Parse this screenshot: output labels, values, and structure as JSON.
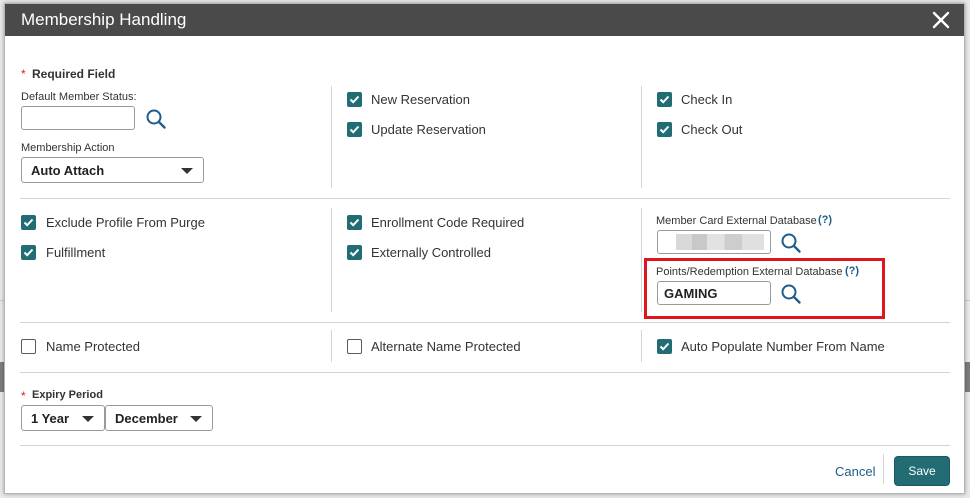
{
  "dialog": {
    "title": "Membership Handling"
  },
  "required_note": {
    "star": "*",
    "text": "Required Field"
  },
  "default_member_status": {
    "label": "Default Member Status:",
    "value": ""
  },
  "membership_action": {
    "label": "Membership Action",
    "value": "Auto Attach"
  },
  "checkboxes": {
    "new_reservation": {
      "label": "New Reservation",
      "checked": true
    },
    "update_reservation": {
      "label": "Update Reservation",
      "checked": true
    },
    "check_in": {
      "label": "Check In",
      "checked": true
    },
    "check_out": {
      "label": "Check Out",
      "checked": true
    },
    "exclude_profile": {
      "label": "Exclude Profile From Purge",
      "checked": true
    },
    "fulfillment": {
      "label": "Fulfillment",
      "checked": true
    },
    "enrollment_code": {
      "label": "Enrollment Code Required",
      "checked": true
    },
    "externally_controlled": {
      "label": "Externally Controlled",
      "checked": true
    },
    "name_protected": {
      "label": "Name Protected",
      "checked": false
    },
    "alt_name_protected": {
      "label": "Alternate Name Protected",
      "checked": false
    },
    "auto_populate": {
      "label": "Auto Populate Number From Name",
      "checked": true
    }
  },
  "member_card_db": {
    "label": "Member Card External Database",
    "help": "(?)"
  },
  "points_db": {
    "label": "Points/Redemption External Database",
    "help": "(?)",
    "value": "GAMING"
  },
  "expiry_period": {
    "star": "*",
    "label": "Expiry Period",
    "period_value": "1 Year",
    "month_value": "December"
  },
  "footer": {
    "cancel": "Cancel",
    "save": "Save"
  },
  "colors": {
    "accent": "#216d73",
    "title_bar": "#4a4a4a",
    "highlight": "#e0161e",
    "link": "#1f5c8a"
  }
}
